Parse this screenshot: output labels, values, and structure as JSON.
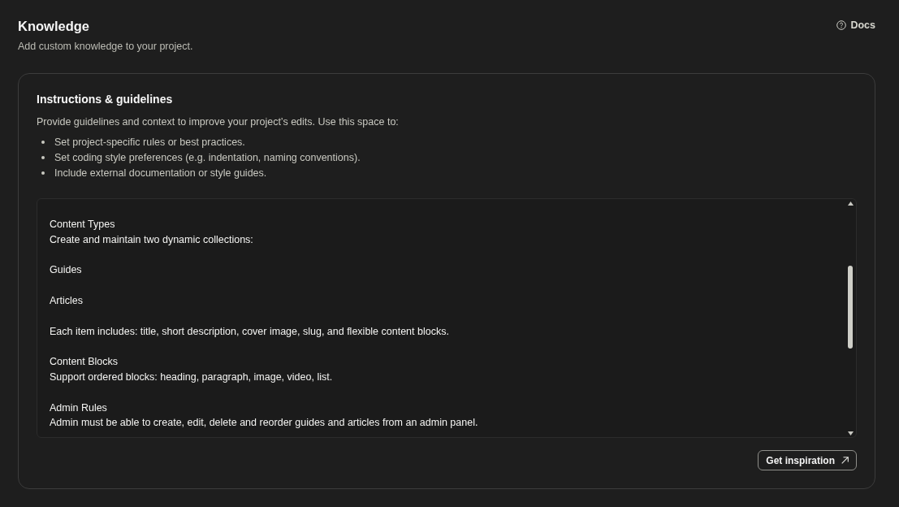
{
  "header": {
    "title": "Knowledge",
    "subtitle": "Add custom knowledge to your project.",
    "docs_link": "Docs"
  },
  "instructions": {
    "title": "Instructions & guidelines",
    "description": "Provide guidelines and context to improve your project’s edits. Use this space to:",
    "bullets": [
      "Set project-specific rules or best practices.",
      "Set coding style preferences (e.g. indentation, naming conventions).",
      "Include external documentation or style guides."
    ],
    "editor": {
      "paragraphs": [
        [
          "Content Types",
          "Create and maintain two dynamic collections:"
        ],
        [
          "Guides"
        ],
        [
          "Articles"
        ],
        [
          "Each item includes: title, short description, cover image, slug, and flexible content blocks."
        ],
        [
          "Content Blocks",
          "Support ordered blocks: heading, paragraph, image, video, list."
        ],
        [
          "Admin Rules",
          "Admin must be able to create, edit, delete and reorder guides and articles from an admin panel."
        ]
      ]
    },
    "button": "Get inspiration"
  }
}
